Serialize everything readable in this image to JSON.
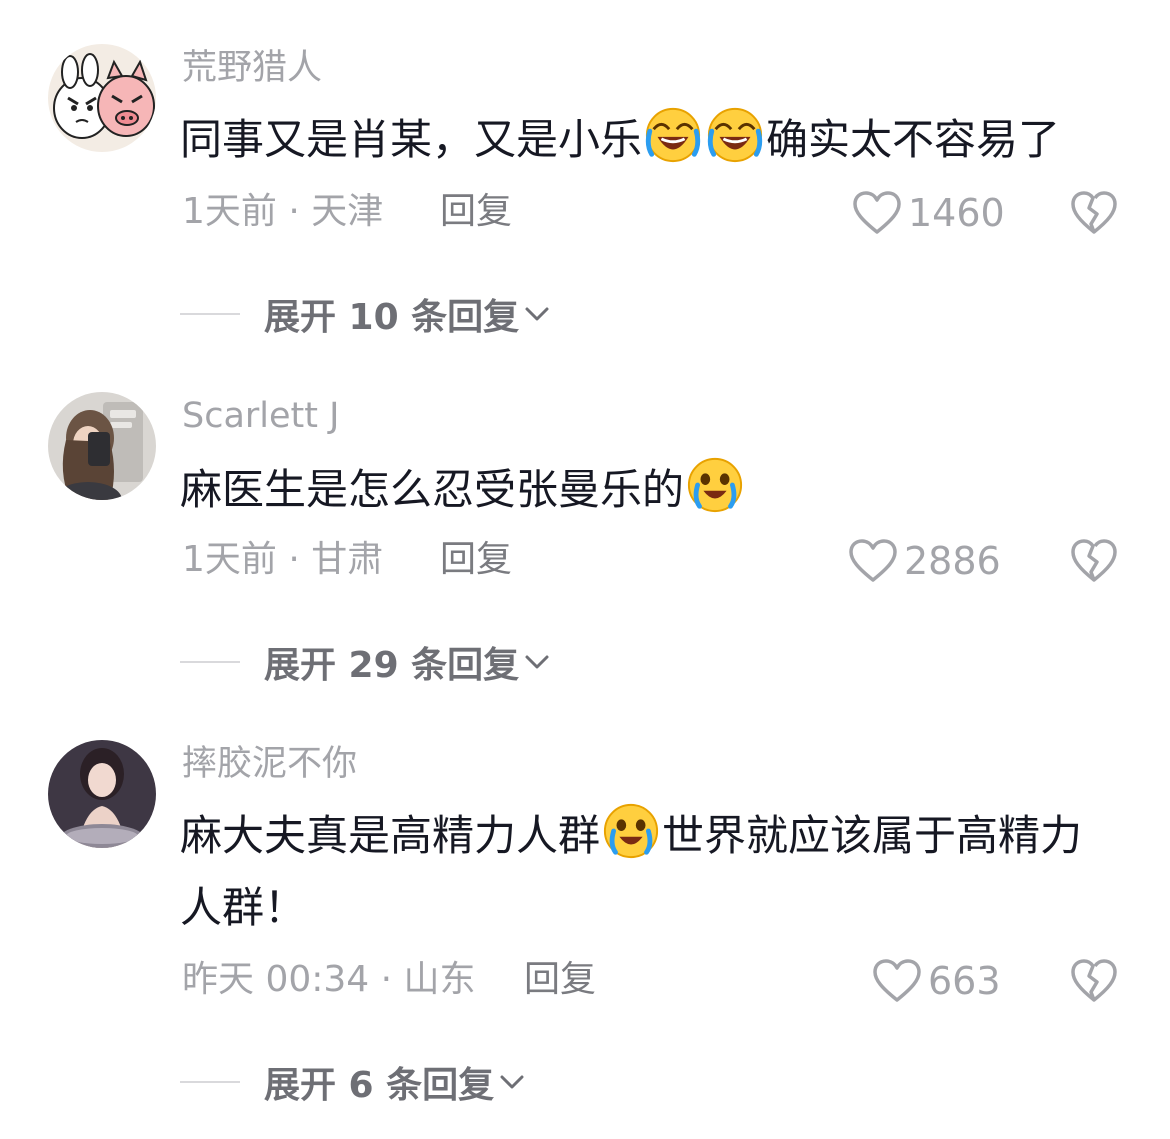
{
  "comments": [
    {
      "username": "荒野猎人",
      "text_parts": [
        "同事又是肖某，又是小乐",
        "",
        "确实太不容易了"
      ],
      "meta": "1天前 · 天津",
      "reply_label": "回复",
      "likes": "1460",
      "expand_label": "展开 10 条回复",
      "avatar": "pig-cartoon-avatar"
    },
    {
      "username": "Scarlett J",
      "text_parts": [
        "麻医生是怎么忍受张曼乐的"
      ],
      "meta": "1天前 · 甘肃",
      "reply_label": "回复",
      "likes": "2886",
      "expand_label": "展开 29 条回复",
      "avatar": "girl-selfie-avatar"
    },
    {
      "username": "摔胶泥不你",
      "text_parts": [
        "麻大夫真是高精力人群",
        "世界就应该属于高精力人群！"
      ],
      "meta": "昨天 00:34 · 山东",
      "reply_label": "回复",
      "likes": "663",
      "expand_label": "展开 6 条回复",
      "avatar": "portrait-avatar"
    }
  ],
  "icons": {
    "like": "heart-outline-icon",
    "dislike": "broken-heart-icon",
    "expand": "chevron-down-icon",
    "emoji_laugh_cry": "rolling-laughing-emoji",
    "emoji_tears": "tears-of-joy-emoji"
  },
  "colors": {
    "text": "#161823",
    "secondary": "#a3a4a9",
    "reply": "#7a7b80",
    "expand": "#6e6f75"
  }
}
